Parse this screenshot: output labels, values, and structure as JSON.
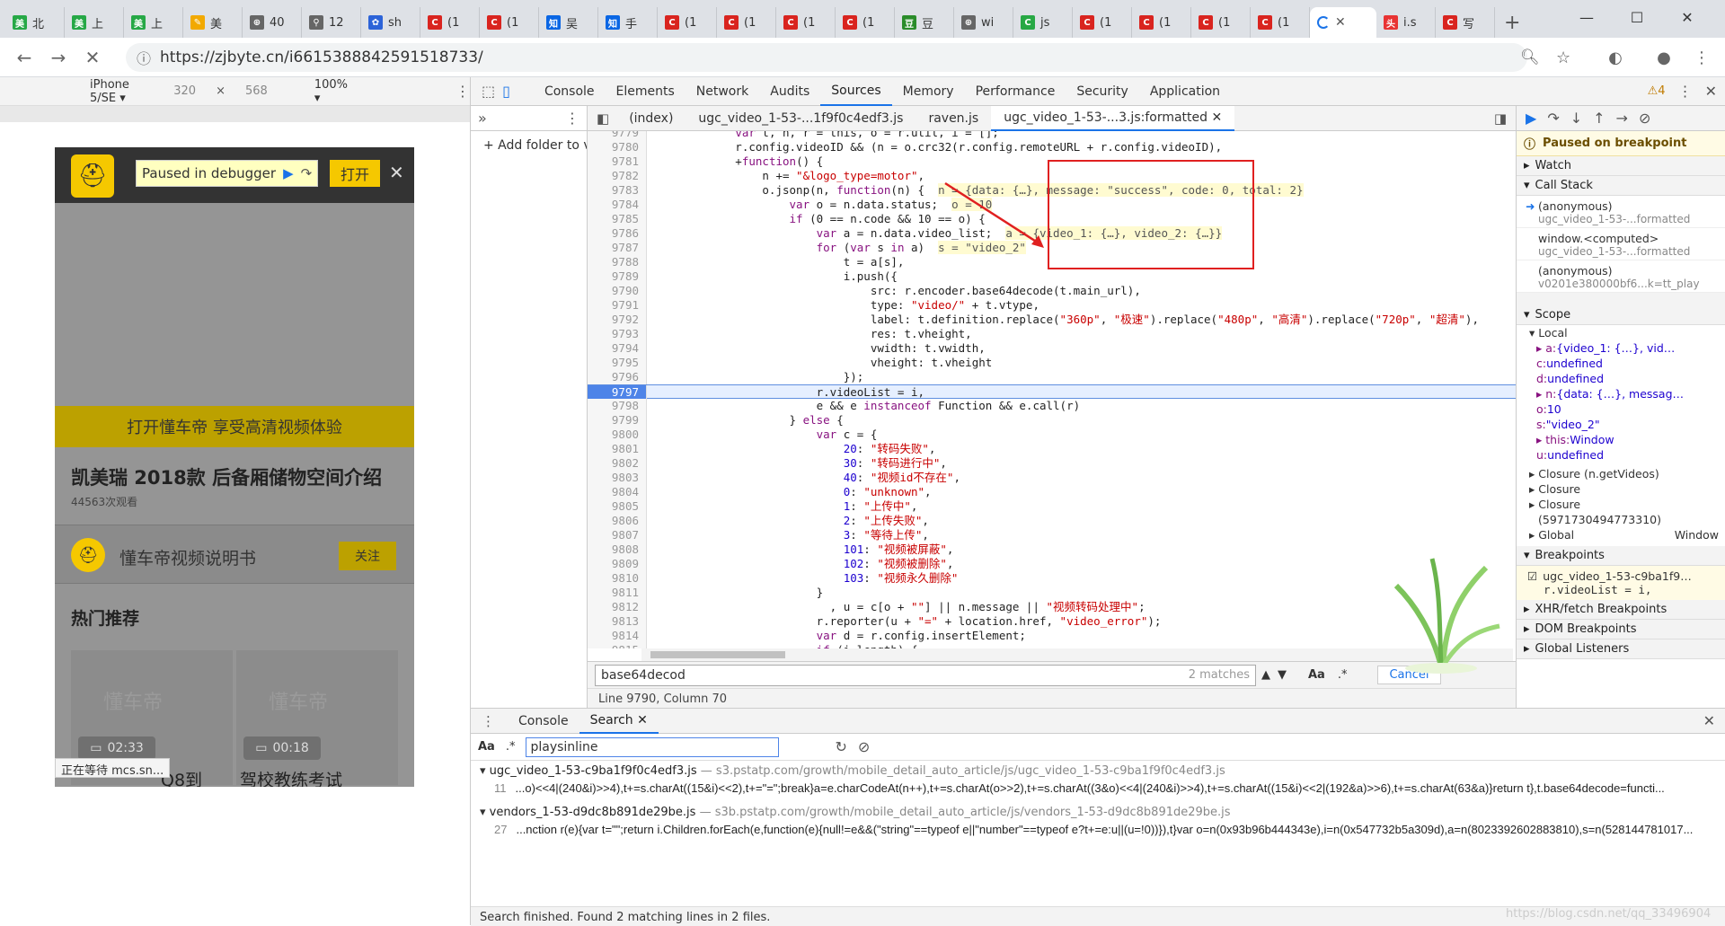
{
  "tabs": [
    {
      "label": "北",
      "fav": "美",
      "color": "#26a846"
    },
    {
      "label": "上",
      "fav": "美",
      "color": "#26a846"
    },
    {
      "label": "上",
      "fav": "美",
      "color": "#26a846"
    },
    {
      "label": "美",
      "fav": "✎",
      "color": "#f2a900"
    },
    {
      "label": "40",
      "fav": "⊕",
      "color": "#666"
    },
    {
      "label": "12",
      "fav": "⚲",
      "color": "#666"
    },
    {
      "label": "sh",
      "fav": "✿",
      "color": "#2c63d8"
    },
    {
      "label": "(1",
      "fav": "C",
      "color": "#d9241f"
    },
    {
      "label": "(1",
      "fav": "C",
      "color": "#d9241f"
    },
    {
      "label": "吴",
      "fav": "知",
      "color": "#0a66e4"
    },
    {
      "label": "手",
      "fav": "知",
      "color": "#0a66e4"
    },
    {
      "label": "(1",
      "fav": "C",
      "color": "#d9241f"
    },
    {
      "label": "(1",
      "fav": "C",
      "color": "#d9241f"
    },
    {
      "label": "(1",
      "fav": "C",
      "color": "#d9241f"
    },
    {
      "label": "(1",
      "fav": "C",
      "color": "#d9241f"
    },
    {
      "label": "豆",
      "fav": "豆",
      "color": "#2a8c2a"
    },
    {
      "label": "wi",
      "fav": "⊕",
      "color": "#666"
    },
    {
      "label": "js",
      "fav": "C",
      "color": "#27a844"
    },
    {
      "label": "(1",
      "fav": "C",
      "color": "#d9241f"
    },
    {
      "label": "(1",
      "fav": "C",
      "color": "#d9241f"
    },
    {
      "label": "(1",
      "fav": "C",
      "color": "#d9241f"
    },
    {
      "label": "(1",
      "fav": "C",
      "color": "#d9241f"
    }
  ],
  "active_tab": {
    "close": "✕"
  },
  "after_tabs": [
    {
      "label": "i.s",
      "fav": "头",
      "color": "#e83333"
    },
    {
      "label": "写",
      "fav": "C",
      "color": "#d9241f"
    }
  ],
  "url": "https://zjbyte.cn/i6615388842591518733/",
  "emu": {
    "device": "iPhone 5/SE ▾",
    "width": "320",
    "height": "568",
    "zoom": "100% ▾",
    "x": "×"
  },
  "phone": {
    "debugger": "Paused in debugger",
    "open_btn": "打开",
    "banner": "打开懂车帝 享受高清视频体验",
    "title": "凯美瑞 2018款 后备厢储物空间介绍",
    "views": "44563次观看",
    "author": "懂车帝视频说明书",
    "follow": "关注",
    "hot": "热门推荐",
    "thumbs": [
      {
        "dur": "02:33",
        "wm": "懂车帝"
      },
      {
        "dur": "00:18",
        "wm": "懂车帝"
      }
    ],
    "cut_left": "Q8到",
    "cut_right": "驾校教练考试",
    "status": "正在等待 mcs.sn..."
  },
  "devtools": {
    "tabs": [
      "Console",
      "Elements",
      "Network",
      "Audits",
      "Sources",
      "Memory",
      "Performance",
      "Security",
      "Application"
    ],
    "active": "Sources",
    "warn": "⚠4",
    "add_folder": "+ Add folder to v",
    "editor_tabs": [
      "(index)",
      "ugc_video_1-53-...1f9f0c4edf3.js",
      "raven.js",
      "ugc_video_1-53-...3.js:formatted ✕"
    ],
    "code_start": 9779,
    "current_line": 9797,
    "code": [
      "            var t, n, r = this, o = r.util, i = [];",
      "            r.config.videoID && (n = o.crc32(r.config.remoteURL + r.config.videoID),",
      "            +function() {",
      "                n += \"&logo_type=motor\",",
      "                o.jsonp(n, function(n) {  n = {data: {…}, message: \"success\", code: 0, total: 2}",
      "                    var o = n.data.status;  o = 10",
      "                    if (0 == n.code && 10 == o) {",
      "                        var a = n.data.video_list;  a = {video_1: {…}, video_2: {…}}",
      "                        for (var s in a)  s = \"video_2\"",
      "                            t = a[s],",
      "                            i.push({",
      "                                src: r.encoder.base64decode(t.main_url),",
      "                                type: \"video/\" + t.vtype,",
      "                                label: t.definition.replace(\"360p\", \"极速\").replace(\"480p\", \"高清\").replace(\"720p\", \"超清\"),",
      "                                res: t.vheight,",
      "                                vwidth: t.vwidth,",
      "                                vheight: t.vheight",
      "                            });",
      "                        r.videoList = i,",
      "                        e && e instanceof Function && e.call(r)",
      "                    } else {",
      "                        var c = {",
      "                            20: \"转码失败\",",
      "                            30: \"转码进行中\",",
      "                            40: \"视频id不存在\",",
      "                            0: \"unknown\",",
      "                            1: \"上传中\",",
      "                            2: \"上传失败\",",
      "                            3: \"等待上传\",",
      "                            101: \"视频被屏蔽\",",
      "                            102: \"视频被删除\",",
      "                            103: \"视频永久删除\"",
      "                        }",
      "                          , u = c[o + \"\"] || n.message || \"视频转码处理中\";",
      "                        r.reporter(u + \"=\" + location.href, \"video_error\");",
      "                        var d = r.config.insertElement;",
      "                        if (i.length) {"
    ],
    "search": {
      "value": "base64decod",
      "matches": "2 matches",
      "aa": "Aa",
      ".*": ".*",
      "cancel": "Cancel"
    },
    "position": "Line 9790, Column 70",
    "sidebar": {
      "paused": "Paused on breakpoint",
      "watch": "Watch",
      "callstack": "Call Stack",
      "frames": [
        {
          "fn": "(anonymous)",
          "loc": "ugc_video_1-53-...formatted"
        },
        {
          "fn": "window.<computed>",
          "loc": "ugc_video_1-53-...formatted"
        },
        {
          "fn": "(anonymous)",
          "loc": "v0201e380000bf6...k=tt_play"
        }
      ],
      "scope": "Scope",
      "local": "Local",
      "locals": [
        {
          "k": "▸ a:",
          "v": " {video_1: {…}, vid…"
        },
        {
          "k": "c:",
          "v": " undefined"
        },
        {
          "k": "d:",
          "v": " undefined"
        },
        {
          "k": "▸ n:",
          "v": " {data: {…}, messag…"
        },
        {
          "k": "o:",
          "v": " 10"
        },
        {
          "k": "s:",
          "v": " \"video_2\""
        },
        {
          "k": "▸ this:",
          "v": " Window"
        },
        {
          "k": "u:",
          "v": " undefined"
        }
      ],
      "closure1": "Closure (n.getVideos)",
      "closure2": "Closure",
      "closure3": "Closure",
      "closure3b": "(5971730494773310)",
      "global": "Global",
      "global_v": "Window",
      "breakpoints": "Breakpoints",
      "bp_file": "ugc_video_1-53-c9ba1f9…",
      "bp_code": "r.videoList = i,",
      "xhr": "XHR/fetch Breakpoints",
      "dom": "DOM Breakpoints",
      "gl": "Global Listeners"
    },
    "drawer": {
      "tabs": [
        "Console",
        "Search ✕"
      ],
      "aa": "Aa",
      "re": ".*",
      "query": "playsinline",
      "results": [
        {
          "file": "ugc_video_1-53-c9ba1f9f0c4edf3.js",
          "path": "— s3.pstatp.com/growth/mobile_detail_auto_article/js/ugc_video_1-53-c9ba1f9f0c4edf3.js",
          "lno": "11",
          "line": "...o)<<4|(240&i)>>4),t+=s.charAt((15&i)<<2),t+=\"=\";break}a=e.charCodeAt(n++),t+=s.charAt(o>>2),t+=s.charAt((3&o)<<4|(240&i)>>4),t+=s.charAt((15&i)<<2|(192&a)>>6),t+=s.charAt(63&a)}return t},t.base64decode=functi..."
        },
        {
          "file": "vendors_1-53-d9dc8b891de29be.js",
          "path": "— s3b.pstatp.com/growth/mobile_detail_auto_article/js/vendors_1-53-d9dc8b891de29be.js",
          "lno": "27",
          "line": "...nction r(e){var t=\"\";return i.Children.forEach(e,function(e){null!=e&&(\"string\"==typeof e||\"number\"==typeof e?t+=e:u||(u=!0))}),t}var o=n(0x93b96b444343e),i=n(0x547732b5a309d),a=n(8023392602883810),s=n(528144781017..."
        }
      ],
      "status": "Search finished.  Found 2 matching lines in 2 files."
    }
  },
  "watermark": "https://blog.csdn.net/qq_33496904"
}
